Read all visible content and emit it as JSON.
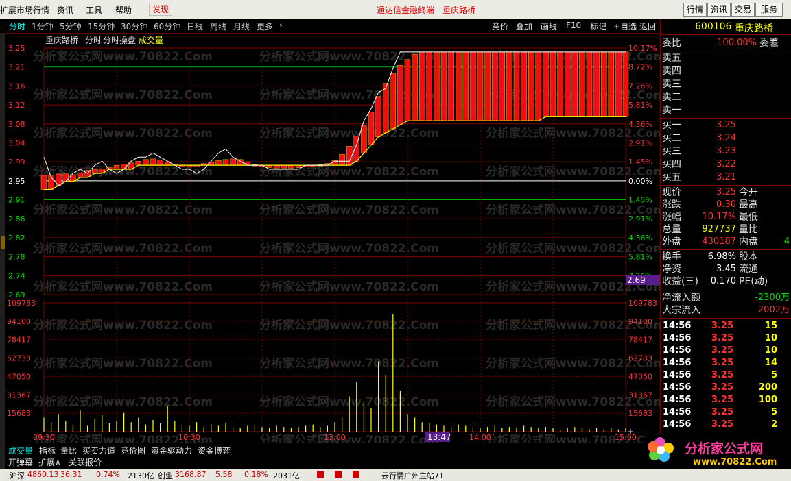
{
  "menu": {
    "items": [
      "扩展市场行情",
      "资讯",
      "工具",
      "帮助"
    ],
    "discover": "发现",
    "center_title": "通达信金融终端",
    "stock_title": "重庆路桥",
    "right_buttons": [
      "行情",
      "资讯",
      "交易",
      "服务"
    ]
  },
  "periods": [
    "分时",
    "1分钟",
    "5分钟",
    "15分钟",
    "30分钟",
    "60分钟",
    "日线",
    "周线",
    "月线",
    "更多"
  ],
  "tools": [
    "竞价",
    "叠加",
    "画线",
    "F10",
    "标记",
    "+自选",
    "返回"
  ],
  "chart_header": {
    "name": "重庆路桥",
    "mode": "分时",
    "indicator": "分时操盘",
    "extra": "成交量"
  },
  "price_axis": {
    "left": [
      "3.25",
      "3.21",
      "3.16",
      "3.12",
      "3.08",
      "3.04",
      "2.99",
      "2.95",
      "2.91",
      "2.86",
      "2.82",
      "2.78",
      "2.74",
      "2.69"
    ],
    "right": [
      "10.17%",
      "8.72%",
      "7.26%",
      "5.81%",
      "4.36%",
      "2.91%",
      "1.45%",
      "0.00%",
      "1.45%",
      "2.91%",
      "4.36%",
      "5.81%",
      "7.26%",
      ""
    ],
    "current_price_tag": "2.69"
  },
  "volume_axis": [
    "109783",
    "94100",
    "78417",
    "62733",
    "47050",
    "31367",
    "15683"
  ],
  "time_axis": [
    "09:30",
    "10:30",
    "13:00",
    "14:00",
    "15:00"
  ],
  "time_cursor": "13:47",
  "bottom_tabs": [
    "成交量",
    "指标",
    "量比",
    "买卖力道",
    "竞价图",
    "资金驱动力",
    "资金博弈"
  ],
  "sub_tabs": [
    "开弹幕",
    "扩展∧",
    "关联报价"
  ],
  "watermark": "分析家公式网www.70822.Com",
  "quote": {
    "code": "600106",
    "name": "重庆路桥",
    "weibi_label": "委比",
    "weibi_value": "100.00%",
    "weicha_label": "委差",
    "sell_labels": [
      "卖五",
      "卖四",
      "卖三",
      "卖二",
      "卖一"
    ],
    "buy_labels": [
      "买一",
      "买二",
      "买三",
      "买四",
      "买五"
    ],
    "buy_prices": [
      "3.25",
      "3.24",
      "3.23",
      "3.22",
      "3.21"
    ],
    "stats": [
      {
        "label": "现价",
        "value": "3.25",
        "label2": "今开"
      },
      {
        "label": "涨跌",
        "value": "0.30",
        "label2": "最高"
      },
      {
        "label": "涨幅",
        "value": "10.17%",
        "label2": "最低"
      },
      {
        "label": "总量",
        "value": "927737",
        "label2": "量比"
      },
      {
        "label": "外盘",
        "value": "430187",
        "label2": "内盘",
        "value2": "4"
      }
    ],
    "stats2": [
      {
        "label": "换手",
        "value": "6.98%",
        "label2": "股本"
      },
      {
        "label": "净资",
        "value": "3.45",
        "label2": "流通"
      },
      {
        "label": "收益(三)",
        "value": "0.170",
        "label2": "PE(动)"
      }
    ],
    "flow": [
      {
        "label": "净流入额",
        "value": "-2300万"
      },
      {
        "label": "大宗流入",
        "value": "2002万"
      }
    ],
    "ticks": [
      {
        "time": "14:56",
        "price": "3.25",
        "vol": "15"
      },
      {
        "time": "14:56",
        "price": "3.25",
        "vol": "10"
      },
      {
        "time": "14:56",
        "price": "3.25",
        "vol": "10"
      },
      {
        "time": "14:56",
        "price": "3.25",
        "vol": "14"
      },
      {
        "time": "14:56",
        "price": "3.25",
        "vol": "5"
      },
      {
        "time": "14:56",
        "price": "3.25",
        "vol": "200"
      },
      {
        "time": "14:56",
        "price": "3.25",
        "vol": "100"
      },
      {
        "time": "14:56",
        "price": "3.25",
        "vol": "5"
      },
      {
        "time": "14:56",
        "price": "3.25",
        "vol": "2"
      }
    ]
  },
  "logo": {
    "name": "分析家公式网",
    "url": "www.70822.Com"
  },
  "status": {
    "index1_name": "沪深",
    "index1_value": "4860.13",
    "index1_change": "36.31",
    "index1_pct": "0.74%",
    "index1_amount": "2130亿",
    "index2_name": "创业",
    "index2_value": "3168.87",
    "index2_change": "5.58",
    "index2_pct": "0.18%",
    "index2_amount": "2031亿",
    "right_text": "云行情广州主站71"
  },
  "chart_data": {
    "type": "line",
    "prev_close": 2.95,
    "ylim": [
      2.65,
      3.26
    ],
    "price": [
      2.99,
      2.94,
      2.92,
      2.93,
      2.95,
      2.96,
      2.95,
      2.97,
      2.98,
      2.96,
      2.95,
      2.96,
      2.98,
      2.99,
      2.99,
      3.0,
      2.99,
      2.98,
      2.97,
      2.96,
      2.96,
      2.95,
      2.96,
      2.98,
      3.0,
      3.01,
      2.99,
      2.98,
      2.97,
      2.97,
      2.97,
      2.96,
      2.96,
      2.96,
      2.96,
      2.96,
      2.97,
      2.97,
      2.97,
      2.97,
      2.98,
      2.98,
      2.98,
      3.02,
      3.08,
      3.11,
      3.15,
      3.16,
      3.21,
      3.25,
      3.25,
      3.25,
      3.25,
      3.25,
      3.25,
      3.25,
      3.25,
      3.25,
      3.25,
      3.25,
      3.25,
      3.25,
      3.25,
      3.25,
      3.25,
      3.25,
      3.25,
      3.25,
      3.25,
      3.25,
      3.25,
      3.25,
      3.25,
      3.25,
      3.25,
      3.25,
      3.25,
      3.25,
      3.25,
      3.25,
      3.25
    ],
    "avg": [
      2.91,
      2.91,
      2.92,
      2.93,
      2.93,
      2.94,
      2.94,
      2.95,
      2.95,
      2.96,
      2.96,
      2.96,
      2.96,
      2.97,
      2.97,
      2.97,
      2.97,
      2.97,
      2.97,
      2.97,
      2.97,
      2.97,
      2.97,
      2.97,
      2.97,
      2.97,
      2.97,
      2.97,
      2.97,
      2.97,
      2.97,
      2.97,
      2.97,
      2.97,
      2.97,
      2.97,
      2.97,
      2.97,
      2.97,
      2.97,
      2.97,
      2.97,
      2.97,
      2.98,
      3.0,
      3.02,
      3.04,
      3.05,
      3.06,
      3.07,
      3.08,
      3.08,
      3.08,
      3.08,
      3.08,
      3.08,
      3.08,
      3.08,
      3.08,
      3.08,
      3.08,
      3.08,
      3.08,
      3.08,
      3.08,
      3.08,
      3.08,
      3.08,
      3.08,
      3.09,
      3.09,
      3.09,
      3.09,
      3.09,
      3.09,
      3.09,
      3.09,
      3.09,
      3.09,
      3.09,
      3.09
    ],
    "volume": [
      12000,
      8000,
      15000,
      9000,
      6000,
      18000,
      5000,
      11000,
      14000,
      7000,
      9000,
      16000,
      8000,
      12000,
      6000,
      10000,
      7000,
      22000,
      9000,
      6000,
      5000,
      8000,
      4000,
      6000,
      5000,
      7000,
      4000,
      3000,
      5000,
      6000,
      4000,
      3000,
      5000,
      4000,
      3000,
      4000,
      5000,
      6000,
      4000,
      5000,
      8000,
      12000,
      30000,
      42000,
      25000,
      20000,
      60000,
      48000,
      100000,
      35000,
      15000,
      12000,
      8000,
      7000,
      6000,
      5000,
      4000,
      6000,
      5000,
      4000,
      3000,
      4000,
      5000,
      3000,
      4000,
      3000,
      5000,
      4000,
      3000,
      4000,
      3000,
      2000,
      3000,
      4000,
      3000,
      2000,
      3000,
      2000,
      3000,
      2000,
      3000
    ]
  }
}
